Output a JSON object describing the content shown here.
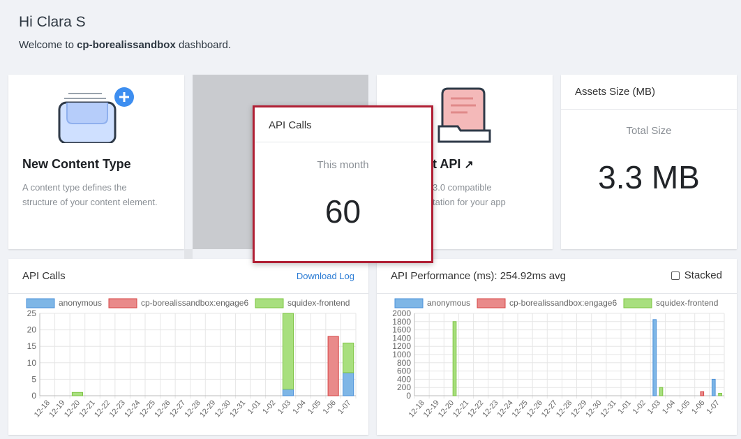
{
  "header": {
    "greeting": "Hi Clara S",
    "welcome_prefix": "Welcome to",
    "app_name": "cp-borealissandbox",
    "welcome_suffix": "dashboard."
  },
  "tiles": {
    "new_content_type": {
      "title": "New Content Type",
      "description": "A content type defines the structure of your content element.",
      "icon": "content-type-icon"
    },
    "api_docs": {
      "title_visible": "t API",
      "description_line1": "3.0 compatible",
      "description_line2": "tation for your app",
      "icon": "document-folder-icon"
    }
  },
  "assets_card": {
    "title": "Assets Size (MB)",
    "label": "Total Size",
    "value": "3.3 MB"
  },
  "popup": {
    "title": "API Calls",
    "label": "This month",
    "value": "60",
    "border_color": "#b01f34"
  },
  "calls_card": {
    "title": "API Calls",
    "download_label": "Download Log"
  },
  "perf_card": {
    "title": "API Performance (ms): 254.92ms avg",
    "stacked_label": "Stacked",
    "stacked_checked": false
  },
  "chart_data": [
    {
      "type": "bar",
      "stacked": true,
      "categories": [
        "12-18",
        "12-19",
        "12-20",
        "12-21",
        "12-22",
        "12-23",
        "12-24",
        "12-25",
        "12-26",
        "12-27",
        "12-28",
        "12-29",
        "12-30",
        "12-31",
        "1-01",
        "1-02",
        "1-03",
        "1-04",
        "1-05",
        "1-06",
        "1-07"
      ],
      "series": [
        {
          "name": "anonymous",
          "color": "#7eb6e6",
          "border": "#4a90d9",
          "values": [
            0,
            0,
            0,
            0,
            0,
            0,
            0,
            0,
            0,
            0,
            0,
            0,
            0,
            0,
            0,
            0,
            2,
            0,
            0,
            0,
            7
          ]
        },
        {
          "name": "cp-borealissandbox:engage6",
          "color": "#e98a8a",
          "border": "#d64545",
          "values": [
            0,
            0,
            0,
            0,
            0,
            0,
            0,
            0,
            0,
            0,
            0,
            0,
            0,
            0,
            0,
            0,
            0,
            0,
            0,
            18,
            0
          ]
        },
        {
          "name": "squidex-frontend",
          "color": "#a8df7e",
          "border": "#7cc441",
          "values": [
            0,
            0,
            1,
            0,
            0,
            0,
            0,
            0,
            0,
            0,
            0,
            0,
            0,
            0,
            0,
            0,
            23,
            0,
            0,
            0,
            9
          ]
        }
      ],
      "ylim": [
        0,
        25
      ],
      "yticks": [
        0,
        5,
        10,
        15,
        20,
        25
      ],
      "legend": "top",
      "grid": true
    },
    {
      "type": "bar",
      "stacked": false,
      "categories": [
        "12-18",
        "12-19",
        "12-20",
        "12-21",
        "12-22",
        "12-23",
        "12-24",
        "12-25",
        "12-26",
        "12-27",
        "12-28",
        "12-29",
        "12-30",
        "12-31",
        "1-01",
        "1-02",
        "1-03",
        "1-04",
        "1-05",
        "1-06",
        "1-07"
      ],
      "series": [
        {
          "name": "anonymous",
          "color": "#7eb6e6",
          "border": "#4a90d9",
          "values": [
            0,
            0,
            0,
            0,
            0,
            0,
            0,
            0,
            0,
            0,
            0,
            0,
            0,
            0,
            0,
            0,
            1850,
            0,
            0,
            0,
            400
          ]
        },
        {
          "name": "cp-borealissandbox:engage6",
          "color": "#e98a8a",
          "border": "#d64545",
          "values": [
            0,
            0,
            0,
            0,
            0,
            0,
            0,
            0,
            0,
            0,
            0,
            0,
            0,
            0,
            0,
            0,
            0,
            0,
            0,
            100,
            0
          ]
        },
        {
          "name": "squidex-frontend",
          "color": "#a8df7e",
          "border": "#7cc441",
          "values": [
            0,
            0,
            1800,
            0,
            0,
            0,
            0,
            0,
            0,
            0,
            0,
            0,
            0,
            0,
            0,
            0,
            200,
            0,
            0,
            0,
            60
          ]
        }
      ],
      "ylim": [
        0,
        2000
      ],
      "yticks": [
        0,
        200,
        400,
        600,
        800,
        1000,
        1200,
        1400,
        1600,
        1800,
        2000
      ],
      "legend": "top",
      "grid": true
    }
  ]
}
